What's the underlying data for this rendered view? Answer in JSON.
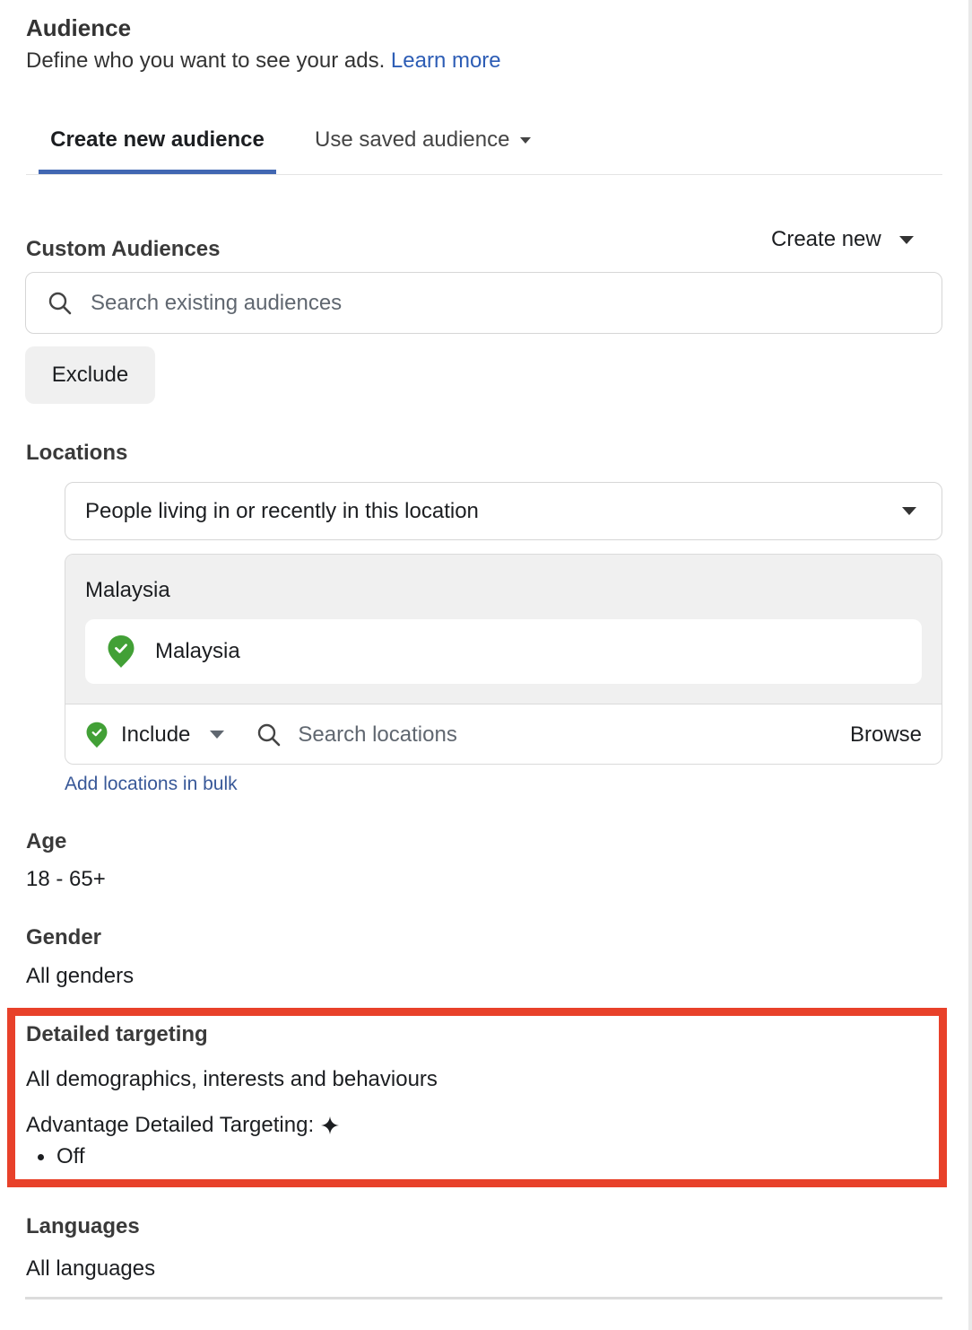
{
  "header": {
    "title": "Audience",
    "description": "Define who you want to see your ads.",
    "learn_more": "Learn more"
  },
  "tabs": [
    {
      "label": "Create new audience",
      "active": true
    },
    {
      "label": "Use saved audience",
      "active": false,
      "has_dropdown": true
    }
  ],
  "custom_audiences": {
    "title": "Custom Audiences",
    "create_new_label": "Create new",
    "search_placeholder": "Search existing audiences",
    "exclude_label": "Exclude"
  },
  "locations": {
    "title": "Locations",
    "type_selected": "People living in or recently in this location",
    "group_label": "Malaysia",
    "selected": [
      {
        "name": "Malaysia",
        "mode": "include"
      }
    ],
    "include_label": "Include",
    "search_placeholder": "Search locations",
    "browse_label": "Browse",
    "bulk_link": "Add locations in bulk"
  },
  "age": {
    "title": "Age",
    "value": "18 - 65+"
  },
  "gender": {
    "title": "Gender",
    "value": "All genders"
  },
  "detailed_targeting": {
    "title": "Detailed targeting",
    "value": "All demographics, interests and behaviours",
    "advantage_label": "Advantage Detailed Targeting:",
    "advantage_icon": "sparkle-icon",
    "advantage_status": "Off",
    "highlighted": true
  },
  "languages": {
    "title": "Languages",
    "value": "All languages"
  },
  "colors": {
    "link": "#2d5db5",
    "tab_active_underline": "#4267b2",
    "include_green": "#42a036",
    "highlight_red": "#e8412a"
  }
}
